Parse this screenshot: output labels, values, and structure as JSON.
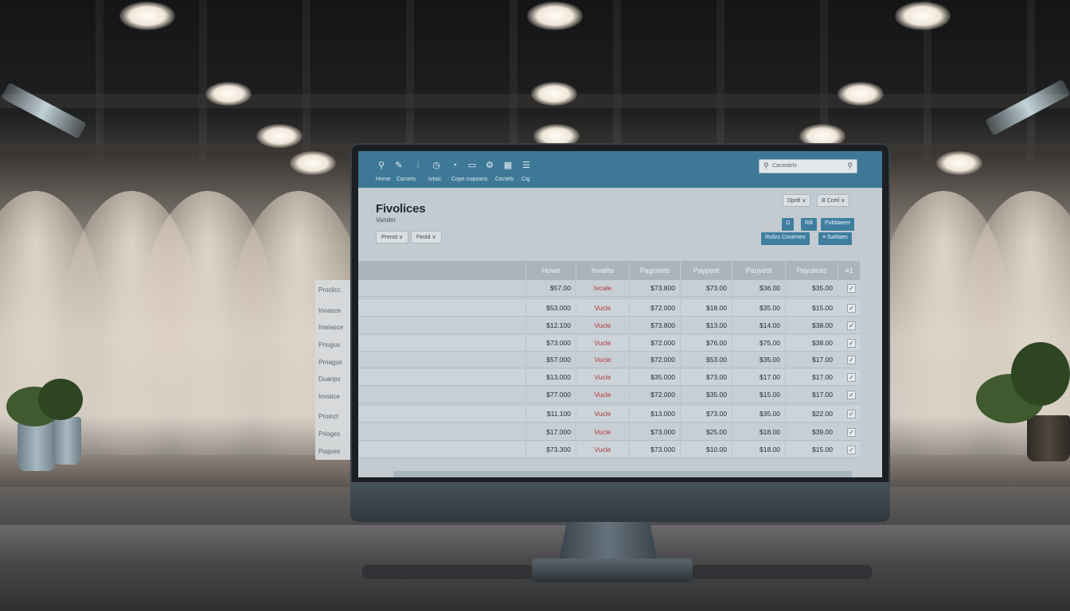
{
  "app": {
    "title": "Fivolices",
    "subtitle": "Vander"
  },
  "nav": {
    "icons": [
      "search-icon",
      "pen-icon",
      "sliders-icon",
      "clock-icon",
      "gauge-icon",
      "card-icon",
      "settings-icon",
      "grid-icon",
      "doc-icon"
    ],
    "labels": [
      "Home",
      "Carsets",
      "Ivtoic",
      "Cope nopoans",
      "Cectels",
      "Cig"
    ]
  },
  "search": {
    "placeholder": "Cacestirls"
  },
  "filters": {
    "first": "Prenst ∨",
    "second": "Feold ∨"
  },
  "selectors": {
    "first": "Dpntl ∨",
    "second": "B Cceil ∨"
  },
  "actions": {
    "row1": [
      "Ω",
      "Rill",
      "Pubblaeer"
    ],
    "row2": [
      "Rollzs Cosemes",
      "≡ Sarltaes"
    ]
  },
  "side_panel": {
    "items": [
      "Proclicc",
      "Innasce",
      "Inwiasce",
      "Pnogus",
      "Prnagus",
      "Duanps",
      "Invsiice",
      "Proinct",
      "Prioges",
      "Puques"
    ]
  },
  "table": {
    "columns": [
      "",
      "Howe",
      "Invalite",
      "Pagcents",
      "Paypest",
      "Pauyest",
      "Payulices",
      "≡1"
    ],
    "rows": [
      {
        "howe": "$57.00",
        "status": "Ivcale",
        "pagcents": "$73.800",
        "paypest": "$73.00",
        "pauyest": "$36.00",
        "payulices": "$35.00"
      },
      {
        "howe": "$53.000",
        "status": "Vucle",
        "pagcents": "$72.000",
        "paypest": "$18.00",
        "pauyest": "$35.00",
        "payulices": "$15.00"
      },
      {
        "howe": "$12.100",
        "status": "Vucle",
        "pagcents": "$73.800",
        "paypest": "$13.00",
        "pauyest": "$14.00",
        "payulices": "$38.00"
      },
      {
        "howe": "$73.000",
        "status": "Vucle",
        "pagcents": "$72.000",
        "paypest": "$76.00",
        "pauyest": "$75.00",
        "payulices": "$38.00"
      },
      {
        "howe": "$57.000",
        "status": "Vucle",
        "pagcents": "$72.000",
        "paypest": "$53.00",
        "pauyest": "$35.00",
        "payulices": "$17.00"
      },
      {
        "howe": "$13.000",
        "status": "Vucle",
        "pagcents": "$35.000",
        "paypest": "$73.00",
        "pauyest": "$17.00",
        "payulices": "$17.00"
      },
      {
        "howe": "$77.000",
        "status": "Vucle",
        "pagcents": "$72.000",
        "paypest": "$35.00",
        "pauyest": "$15.00",
        "payulices": "$17.00"
      },
      {
        "howe": "$11.100",
        "status": "Vucle",
        "pagcents": "$13.000",
        "paypest": "$73.00",
        "pauyest": "$35.00",
        "payulices": "$22.00"
      },
      {
        "howe": "$17.000",
        "status": "Vucle",
        "pagcents": "$73.000",
        "paypest": "$25.00",
        "pauyest": "$18.00",
        "payulices": "$39.00"
      },
      {
        "howe": "$73.300",
        "status": "Vucle",
        "pagcents": "$73.000",
        "paypest": "$10.00",
        "pauyest": "$18.00",
        "payulices": "$15.00"
      }
    ]
  },
  "colors": {
    "topbar": "#3d7897",
    "accent": "#3f7ea0",
    "status_red": "#b0353a"
  }
}
